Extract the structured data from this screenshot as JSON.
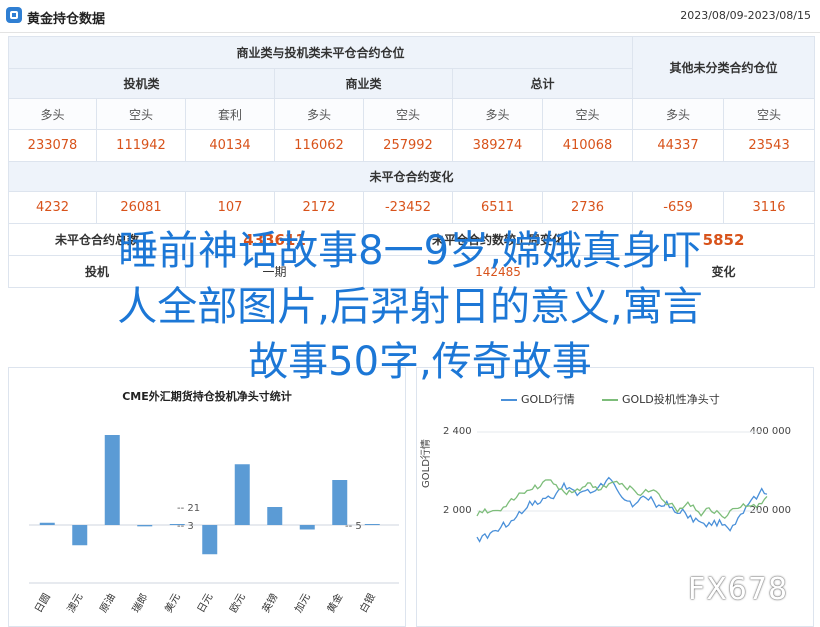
{
  "header": {
    "title": "黄金持仓数据",
    "date_range": "2023/08/09-2023/08/15"
  },
  "table": {
    "group1_title": "商业类与投机类未平仓合约仓位",
    "group2_title": "其他未分类合约仓位",
    "sub_headers": [
      "投机类",
      "商业类",
      "总计"
    ],
    "col_labels": [
      "多头",
      "空头",
      "套利",
      "多头",
      "空头",
      "多头",
      "空头",
      "多头",
      "空头"
    ],
    "positions": [
      "233078",
      "111942",
      "40134",
      "116062",
      "257992",
      "389274",
      "410068",
      "44337",
      "23543"
    ],
    "change_title": "未平仓合约变化",
    "changes": [
      "4232",
      "26081",
      "107",
      "2172",
      "-23452",
      "6511",
      "2736",
      "-659",
      "3116"
    ],
    "total_label": "未平仓合约总数",
    "total_value": "433611",
    "prev_change_label": "未平仓合约数较上周变化",
    "prev_change_value": "5852"
  },
  "hidden_fragments": {
    "row_left": "投机",
    "row_dash": "一期",
    "row_right": "变化",
    "row_num": "142485",
    "mid_dash": "-- 21",
    "mid_1": "-- 3",
    "mid_2": "-- 5"
  },
  "overlay": {
    "line1": "睡前神话故事8一9岁,嫦娥真身吓",
    "line2": "人全部图片,后羿射日的意义,寓言",
    "line3": "故事50字,传奇故事"
  },
  "watermark": "FX678",
  "chart_data": [
    {
      "type": "bar",
      "title": "CME外汇期货持仓投机净头寸统计",
      "categories": [
        "日圆",
        "澳元",
        "原油",
        "瑞郎",
        "美元",
        "日元",
        "欧元",
        "英镑",
        "加元",
        "黄金",
        "白银"
      ],
      "values": [
        0.5,
        -4.5,
        20,
        -0.3,
        0.2,
        -6.5,
        13.5,
        4,
        -1,
        10,
        0.1
      ],
      "colors": {
        "bar": "#5b9bd5"
      }
    },
    {
      "type": "line",
      "series": [
        {
          "name": "GOLD行情",
          "color": "#4a90d9"
        },
        {
          "name": "GOLD投机性净头寸",
          "color": "#7dbd7a"
        }
      ],
      "y_left_ticks": [
        "2 400",
        "2 000"
      ],
      "y_left_label": "GOLD行情",
      "y_right_ticks": [
        "400 000",
        "200 000"
      ]
    }
  ]
}
